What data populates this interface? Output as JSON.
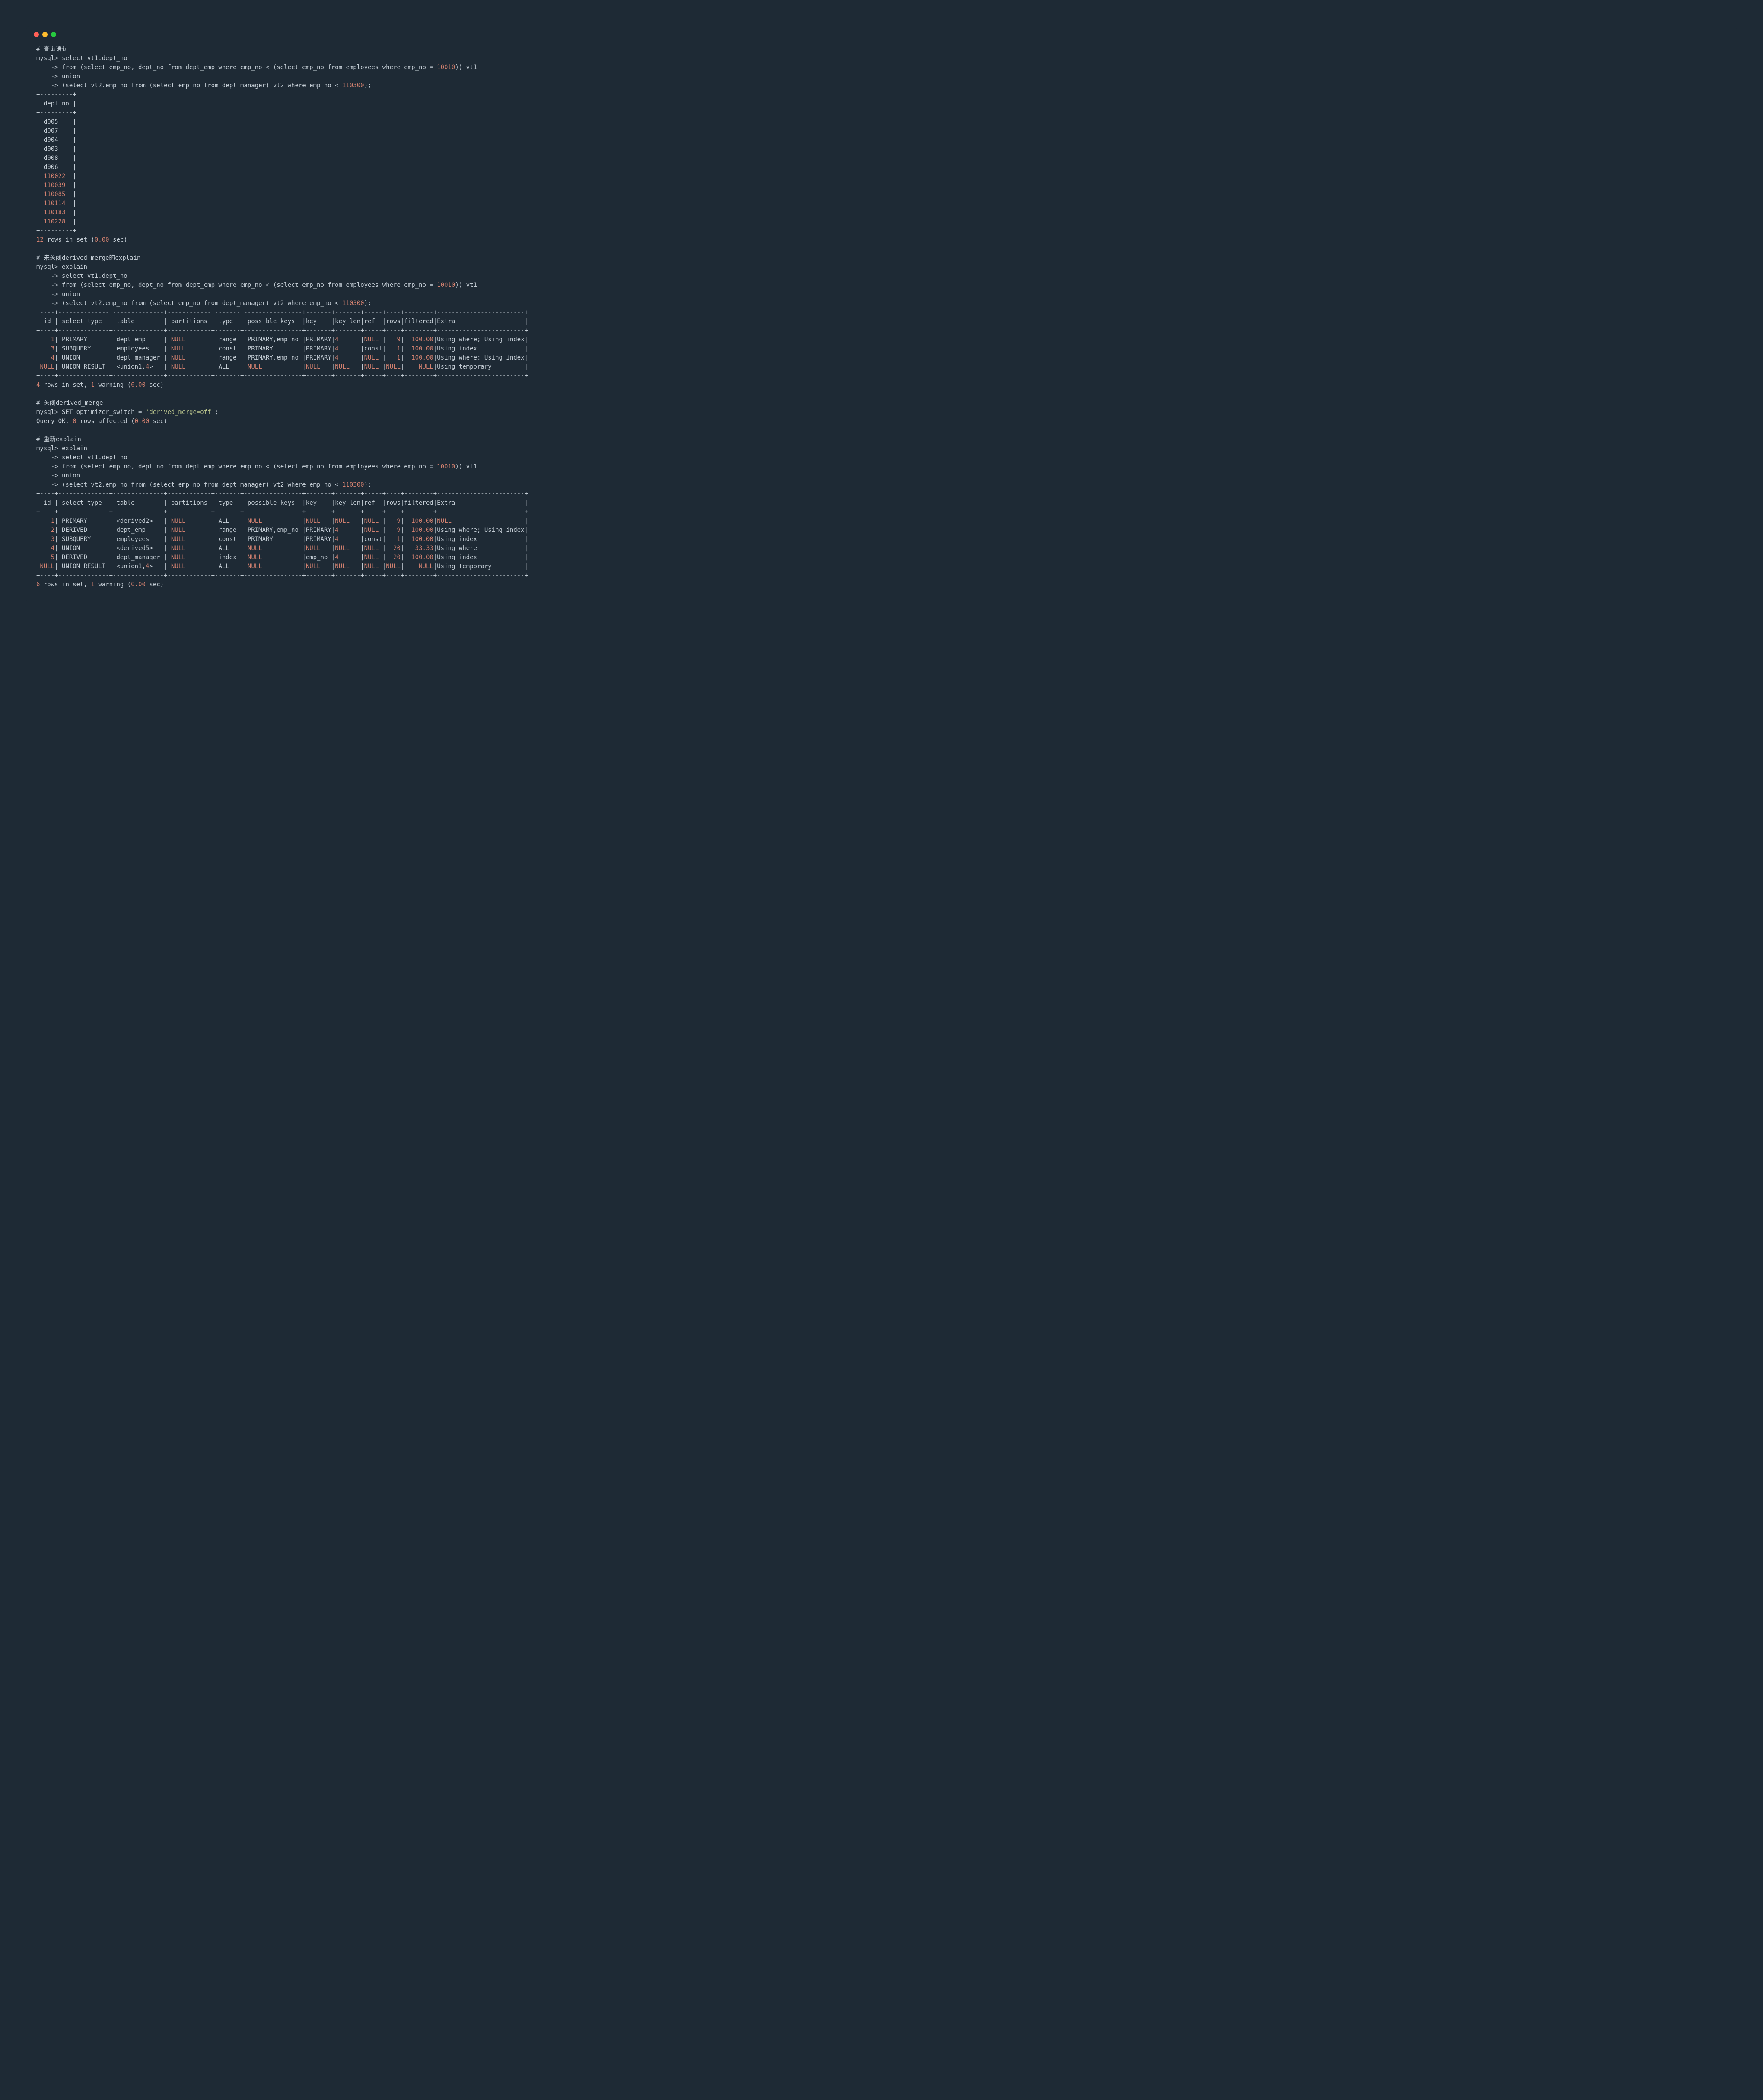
{
  "titlebar": {
    "dots": [
      "red",
      "yellow",
      "green"
    ]
  },
  "s1": {
    "comment": "# 查询语句",
    "l1_a": "mysql> select vt1.dept_no",
    "l2_a": "    -> from (select emp_no, dept_no from dept_emp where emp_no < (select emp_no from employees where emp_no = ",
    "l2_n": "10010",
    "l2_b": ")) vt1",
    "l3_a": "    -> union",
    "l4_a": "    -> (select vt2.emp_no from (select emp_no from dept_manager) vt2 where emp_no < ",
    "l4_n": "110300",
    "l4_b": ");",
    "sep": "+---------+",
    "head": "| dept_no |",
    "rows_txt": [
      "| d005    |",
      "| d007    |",
      "| d004    |",
      "| d003    |",
      "| d008    |",
      "| d006    |"
    ],
    "rows_num": [
      {
        "pre": "| ",
        "n": "110022",
        "post": "  |"
      },
      {
        "pre": "| ",
        "n": "110039",
        "post": "  |"
      },
      {
        "pre": "| ",
        "n": "110085",
        "post": "  |"
      },
      {
        "pre": "| ",
        "n": "110114",
        "post": "  |"
      },
      {
        "pre": "| ",
        "n": "110183",
        "post": "  |"
      },
      {
        "pre": "| ",
        "n": "110228",
        "post": "  |"
      }
    ],
    "sum_a": "12",
    "sum_b": " rows in set (",
    "sum_c": "0.00",
    "sum_d": " sec)"
  },
  "s2": {
    "comment": "# 未关闭derived_merge的explain",
    "l0": "mysql> explain",
    "l1": "    -> select vt1.dept_no",
    "l2_a": "    -> from (select emp_no, dept_no from dept_emp where emp_no < (select emp_no from employees where emp_no = ",
    "l2_n": "10010",
    "l2_b": ")) vt1",
    "l3": "    -> union",
    "l4_a": "    -> (select vt2.emp_no from (select emp_no from dept_manager) vt2 where emp_no < ",
    "l4_n": "110300",
    "l4_b": ");",
    "tsep": "+----+--------------+--------------+------------+-------+----------------+-------+-------+-----+----+--------+------------------------+",
    "thead": "| id | select_type  | table        | partitions | type  | possible_keys  |key    |key_len|ref  |rows|filtered|Extra                   |",
    "rows": [
      [
        {
          "t": "|   "
        },
        {
          "n": "1"
        },
        {
          "t": "| PRIMARY      | dept_emp     | "
        },
        {
          "n": "NULL"
        },
        {
          "t": "       | range | PRIMARY,emp_no |PRIMARY|"
        },
        {
          "n": "4"
        },
        {
          "t": "      |"
        },
        {
          "n": "NULL"
        },
        {
          "t": " |   "
        },
        {
          "n": "9"
        },
        {
          "t": "|  "
        },
        {
          "n": "100.00"
        },
        {
          "t": "|Using where; Using index|"
        }
      ],
      [
        {
          "t": "|   "
        },
        {
          "n": "3"
        },
        {
          "t": "| SUBQUERY     | employees    | "
        },
        {
          "n": "NULL"
        },
        {
          "t": "       | const | PRIMARY        |PRIMARY|"
        },
        {
          "n": "4"
        },
        {
          "t": "      |const|   "
        },
        {
          "n": "1"
        },
        {
          "t": "|  "
        },
        {
          "n": "100.00"
        },
        {
          "t": "|Using index             |"
        }
      ],
      [
        {
          "t": "|   "
        },
        {
          "n": "4"
        },
        {
          "t": "| UNION        | dept_manager | "
        },
        {
          "n": "NULL"
        },
        {
          "t": "       | range | PRIMARY,emp_no |PRIMARY|"
        },
        {
          "n": "4"
        },
        {
          "t": "      |"
        },
        {
          "n": "NULL"
        },
        {
          "t": " |   "
        },
        {
          "n": "1"
        },
        {
          "t": "|  "
        },
        {
          "n": "100.00"
        },
        {
          "t": "|Using where; Using index|"
        }
      ],
      [
        {
          "t": "|"
        },
        {
          "n": "NULL"
        },
        {
          "t": "| UNION RESULT | <union1,"
        },
        {
          "n": "4"
        },
        {
          "t": ">   | "
        },
        {
          "n": "NULL"
        },
        {
          "t": "       | ALL   | "
        },
        {
          "n": "NULL"
        },
        {
          "t": "           |"
        },
        {
          "n": "NULL"
        },
        {
          "t": "   |"
        },
        {
          "n": "NULL"
        },
        {
          "t": "   |"
        },
        {
          "n": "NULL"
        },
        {
          "t": " |"
        },
        {
          "n": "NULL"
        },
        {
          "t": "|    "
        },
        {
          "n": "NULL"
        },
        {
          "t": "|Using temporary         |"
        }
      ]
    ],
    "sum_a": "4",
    "sum_b": " rows in set, ",
    "sum_c": "1",
    "sum_d": " warning (",
    "sum_e": "0.00",
    "sum_f": " sec)"
  },
  "s3": {
    "comment": "# 关闭derived_merge",
    "l_a": "mysql> SET optimizer_switch = ",
    "l_s": "'derived_merge=off'",
    "l_b": ";",
    "ok_a": "Query OK, ",
    "ok_b": "0",
    "ok_c": " rows affected (",
    "ok_d": "0.00",
    "ok_e": " sec)"
  },
  "s4": {
    "comment": "# 重新explain",
    "l0": "mysql> explain",
    "l1": "    -> select vt1.dept_no",
    "l2_a": "    -> from (select emp_no, dept_no from dept_emp where emp_no < (select emp_no from employees where emp_no = ",
    "l2_n": "10010",
    "l2_b": ")) vt1",
    "l3": "    -> union",
    "l4_a": "    -> (select vt2.emp_no from (select emp_no from dept_manager) vt2 where emp_no < ",
    "l4_n": "110300",
    "l4_b": ");",
    "tsep": "+----+--------------+--------------+------------+-------+----------------+-------+-------+-----+----+--------+------------------------+",
    "thead": "| id | select_type  | table        | partitions | type  | possible_keys  |key    |key_len|ref  |rows|filtered|Extra                   |",
    "rows": [
      [
        {
          "t": "|   "
        },
        {
          "n": "1"
        },
        {
          "t": "| PRIMARY      | <derived2>   | "
        },
        {
          "n": "NULL"
        },
        {
          "t": "       | ALL   | "
        },
        {
          "n": "NULL"
        },
        {
          "t": "           |"
        },
        {
          "n": "NULL"
        },
        {
          "t": "   |"
        },
        {
          "n": "NULL"
        },
        {
          "t": "   |"
        },
        {
          "n": "NULL"
        },
        {
          "t": " |   "
        },
        {
          "n": "9"
        },
        {
          "t": "|  "
        },
        {
          "n": "100.00"
        },
        {
          "t": "|"
        },
        {
          "n": "NULL"
        },
        {
          "t": "                    |"
        }
      ],
      [
        {
          "t": "|   "
        },
        {
          "n": "2"
        },
        {
          "t": "| DERIVED      | dept_emp     | "
        },
        {
          "n": "NULL"
        },
        {
          "t": "       | range | PRIMARY,emp_no |PRIMARY|"
        },
        {
          "n": "4"
        },
        {
          "t": "      |"
        },
        {
          "n": "NULL"
        },
        {
          "t": " |   "
        },
        {
          "n": "9"
        },
        {
          "t": "|  "
        },
        {
          "n": "100.00"
        },
        {
          "t": "|Using where; Using index|"
        }
      ],
      [
        {
          "t": "|   "
        },
        {
          "n": "3"
        },
        {
          "t": "| SUBQUERY     | employees    | "
        },
        {
          "n": "NULL"
        },
        {
          "t": "       | const | PRIMARY        |PRIMARY|"
        },
        {
          "n": "4"
        },
        {
          "t": "      |const|   "
        },
        {
          "n": "1"
        },
        {
          "t": "|  "
        },
        {
          "n": "100.00"
        },
        {
          "t": "|Using index             |"
        }
      ],
      [
        {
          "t": "|   "
        },
        {
          "n": "4"
        },
        {
          "t": "| UNION        | <derived5>   | "
        },
        {
          "n": "NULL"
        },
        {
          "t": "       | ALL   | "
        },
        {
          "n": "NULL"
        },
        {
          "t": "           |"
        },
        {
          "n": "NULL"
        },
        {
          "t": "   |"
        },
        {
          "n": "NULL"
        },
        {
          "t": "   |"
        },
        {
          "n": "NULL"
        },
        {
          "t": " |  "
        },
        {
          "n": "20"
        },
        {
          "t": "|   "
        },
        {
          "n": "33.33"
        },
        {
          "t": "|Using where             |"
        }
      ],
      [
        {
          "t": "|   "
        },
        {
          "n": "5"
        },
        {
          "t": "| DERIVED      | dept_manager | "
        },
        {
          "n": "NULL"
        },
        {
          "t": "       | index | "
        },
        {
          "n": "NULL"
        },
        {
          "t": "           |emp_no |"
        },
        {
          "n": "4"
        },
        {
          "t": "      |"
        },
        {
          "n": "NULL"
        },
        {
          "t": " |  "
        },
        {
          "n": "20"
        },
        {
          "t": "|  "
        },
        {
          "n": "100.00"
        },
        {
          "t": "|Using index             |"
        }
      ],
      [
        {
          "t": "|"
        },
        {
          "n": "NULL"
        },
        {
          "t": "| UNION RESULT | <union1,"
        },
        {
          "n": "4"
        },
        {
          "t": ">   | "
        },
        {
          "n": "NULL"
        },
        {
          "t": "       | ALL   | "
        },
        {
          "n": "NULL"
        },
        {
          "t": "           |"
        },
        {
          "n": "NULL"
        },
        {
          "t": "   |"
        },
        {
          "n": "NULL"
        },
        {
          "t": "   |"
        },
        {
          "n": "NULL"
        },
        {
          "t": " |"
        },
        {
          "n": "NULL"
        },
        {
          "t": "|    "
        },
        {
          "n": "NULL"
        },
        {
          "t": "|Using temporary         |"
        }
      ]
    ],
    "sum_a": "6",
    "sum_b": " rows in set, ",
    "sum_c": "1",
    "sum_d": " warning (",
    "sum_e": "0.00",
    "sum_f": " sec)"
  }
}
